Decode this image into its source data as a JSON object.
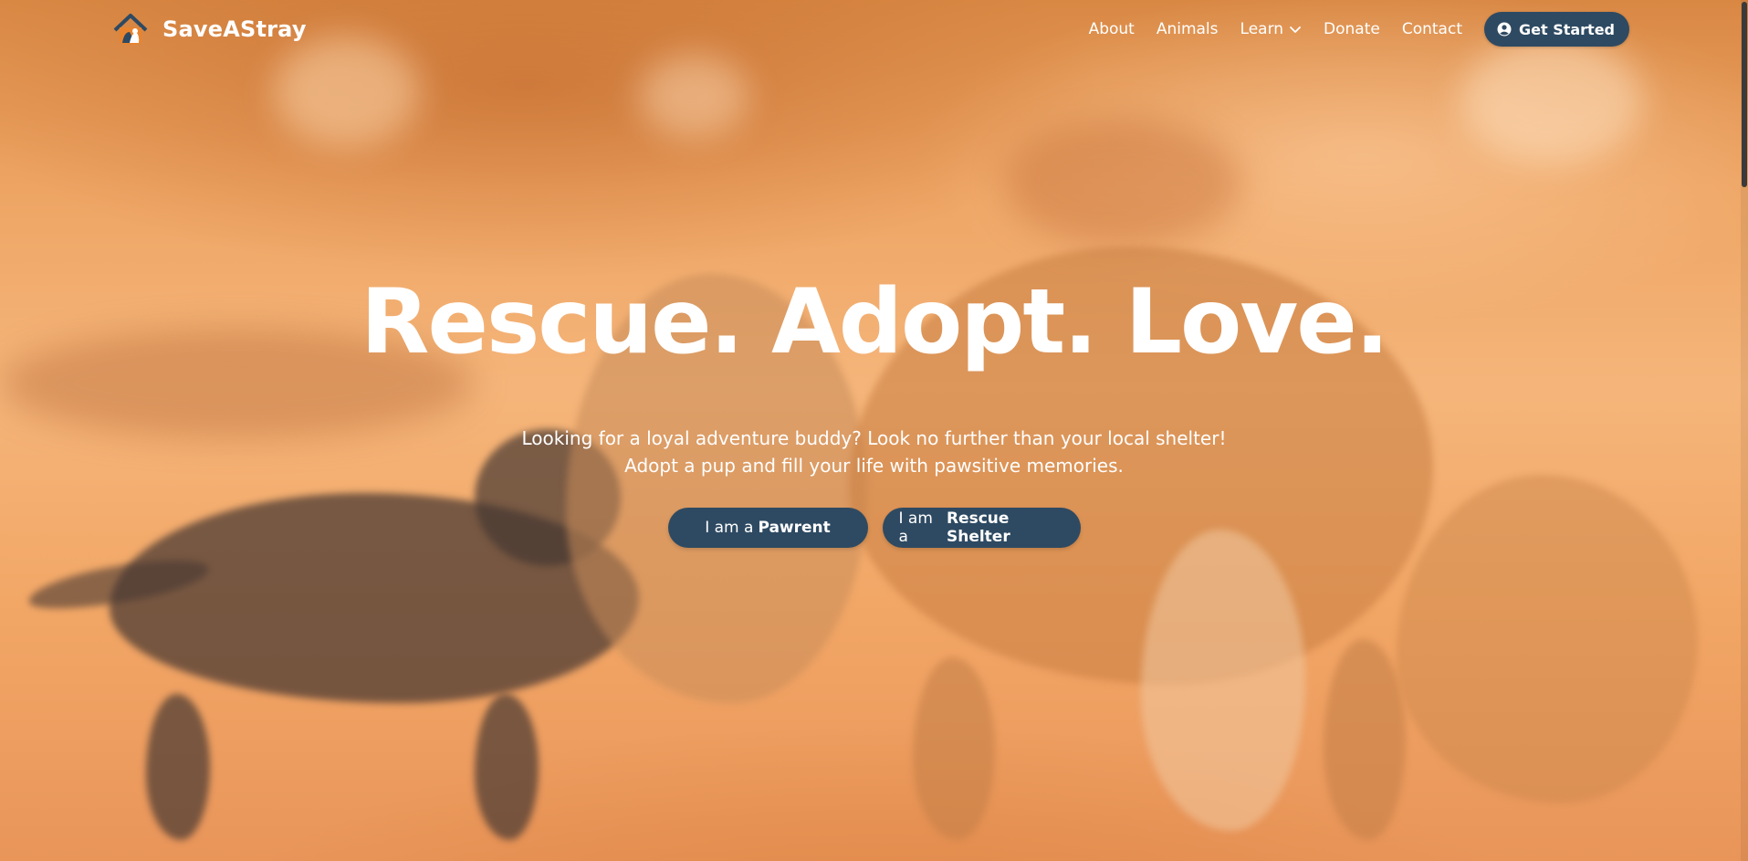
{
  "brand": {
    "name": "SaveAStray",
    "logo_icon": "house-cat-dog-logo-icon"
  },
  "nav": {
    "links": [
      {
        "label": "About"
      },
      {
        "label": "Animals"
      },
      {
        "label": "Learn",
        "has_dropdown": true
      },
      {
        "label": "Donate"
      },
      {
        "label": "Contact"
      }
    ],
    "cta": {
      "label": "Get Started",
      "icon": "user-circle-icon"
    }
  },
  "hero": {
    "headline": "Rescue. Adopt. Love.",
    "subtitle_line1": "Looking for a loyal adventure buddy? Look no further than your local shelter!",
    "subtitle_line2": "Adopt a pup and fill your life with pawsitive memories.",
    "buttons": [
      {
        "prefix": "I am a",
        "emphasis": "Pawrent"
      },
      {
        "prefix": "I am a",
        "emphasis": "Rescue Shelter"
      }
    ],
    "background_image": "orange-tinted photo of puppies playing on a road"
  },
  "colors": {
    "accent_dark": "#2e4a62",
    "hero_tint": "#f4a55f",
    "text_light": "#ffffff"
  }
}
